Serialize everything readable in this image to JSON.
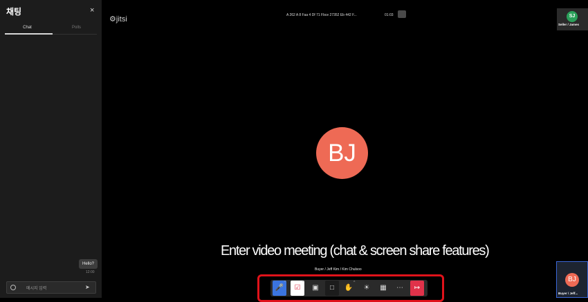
{
  "chat": {
    "title": "채팅",
    "close": "×",
    "tabs": [
      "Chat",
      "Polls"
    ],
    "message": "Hello?",
    "time": "12:00",
    "placeholder": "메시지 입력"
  },
  "header": {
    "logo": "jitsi",
    "meeting_name": "A 262 A 8 Faa 4 Df 71 Fbce 27352 Eb 442 F...",
    "timer": "01:03"
  },
  "participants": {
    "top_thumbnail": {
      "initials": "SJ",
      "name": "Seller / James"
    },
    "main_initials": "BJ",
    "main_name": "Buyer / Jeff Kim / Kim Chulsoo",
    "bottom_thumbnail": {
      "initials": "BJ",
      "name": "Buyer / Jeff..."
    }
  },
  "overlay_text": "Enter video meeting (chat & screen share features)",
  "toolbar": {
    "icons": [
      "microphone-icon",
      "camera-off-icon",
      "screen-share-icon",
      "chat-icon",
      "raise-hand-icon",
      "reactions-icon",
      "tile-view-icon",
      "more-icon",
      "leave-icon"
    ]
  },
  "colors": {
    "avatar_main": "#ee6a55",
    "avatar_seller": "#2aa05a",
    "mic_active": "#3b74e0",
    "leave": "#e0324a",
    "highlight": "#e0121a"
  }
}
